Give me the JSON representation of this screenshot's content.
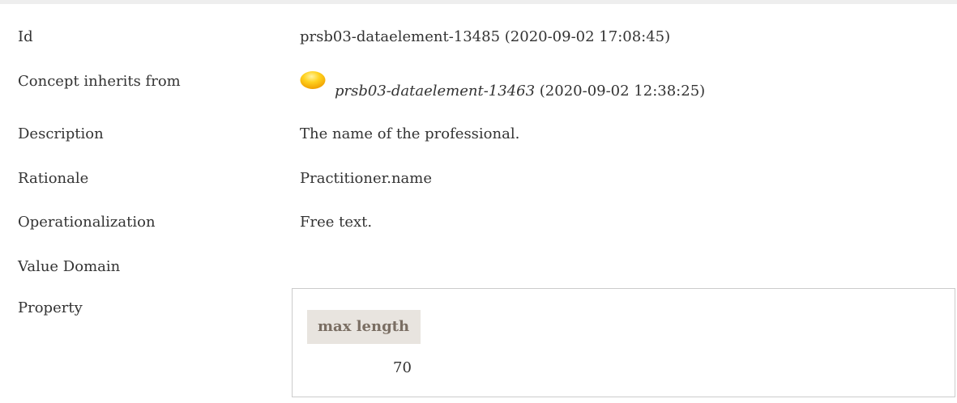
{
  "rows": {
    "id": {
      "label": "Id",
      "value": "prsb03-dataelement-13485 (2020-09-02 17:08:45)"
    },
    "inherits": {
      "label": "Concept inherits from",
      "ref_id": "prsb03-dataelement-13463",
      "ref_date": "(2020-09-02 12:38:25)",
      "status_icon": "status-dot-icon",
      "status_color": "#f5b800"
    },
    "description": {
      "label": "Description",
      "value": "The name of the professional."
    },
    "rationale": {
      "label": "Rationale",
      "value": "Practitioner.name"
    },
    "operationalization": {
      "label": "Operationalization",
      "value": "Free text."
    },
    "value_domain": {
      "label": "Value Domain"
    },
    "property": {
      "label": "Property",
      "table_header": "max length",
      "table_value": "70"
    }
  }
}
